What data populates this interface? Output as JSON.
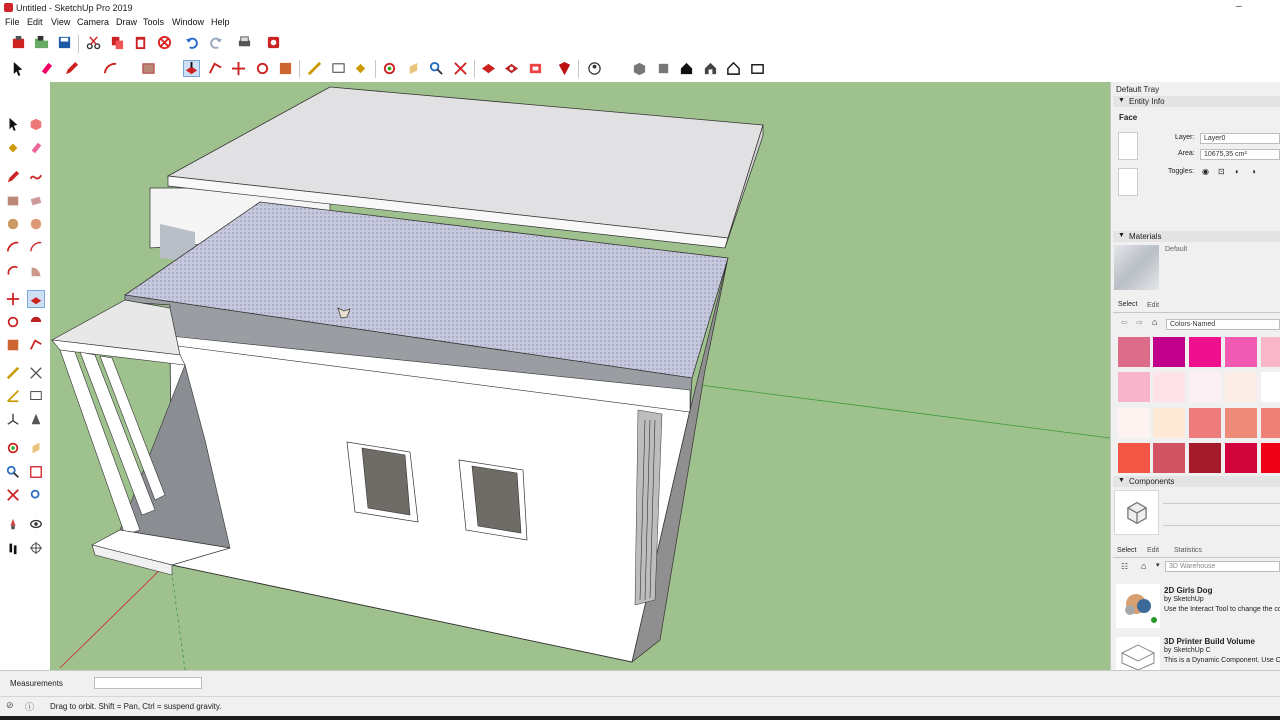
{
  "window": {
    "title": "Untitled - SketchUp Pro 2019",
    "min_glyph": "–"
  },
  "menu": [
    "File",
    "Edit",
    "View",
    "Camera",
    "Draw",
    "Tools",
    "Window",
    "Help"
  ],
  "tray": {
    "title": "Default Tray",
    "entity_info": {
      "header": "Entity Info",
      "type": "Face",
      "layer_label": "Layer:",
      "layer_value": "Layer0",
      "area_label": "Area:",
      "area_value": "10675,35 cm²",
      "toggles_label": "Toggles:"
    },
    "materials": {
      "header": "Materials",
      "current": "Default",
      "tab_select": "Select",
      "tab_edit": "Edit",
      "library": "Colors-Named",
      "swatches": [
        "#dd6b8a",
        "#c0008a",
        "#ee0f8d",
        "#f05ab3",
        "#f7b7c8",
        "#f7b5cb",
        "#fde2e8",
        "#fdf0f4",
        "#fbece6",
        "#ffffff",
        "#fdf4f1",
        "#fde9d5",
        "#ef7c7c",
        "#ee8a78",
        "#ef8078",
        "#f25745",
        "#d25463",
        "#a51b2a",
        "#d2043c",
        "#ee0016"
      ]
    },
    "components": {
      "header": "Components",
      "tab_select": "Select",
      "tab_edit": "Edit",
      "tab_statistics": "Statistics",
      "search_placeholder": "3D Warehouse",
      "items": [
        {
          "name": "2D Girls Dog",
          "by": "by SketchUp",
          "desc": "Use the Interact Tool to change the color of the girls' clothes and the dog"
        },
        {
          "name": "3D Printer Build Volume",
          "by": "by SketchUp C",
          "desc": "This is a Dynamic Component. Use Component Options window to set th"
        }
      ]
    }
  },
  "status": {
    "measurements_label": "Measurements",
    "measurements_value": "",
    "hint": "Drag to orbit. Shift = Pan, Ctrl = suspend gravity."
  },
  "colors": {
    "viewport_bg": "#9fc18d",
    "selection_fill": "#c6c8dd",
    "wall": "#ffffff",
    "roof": "#dcdcdc"
  }
}
